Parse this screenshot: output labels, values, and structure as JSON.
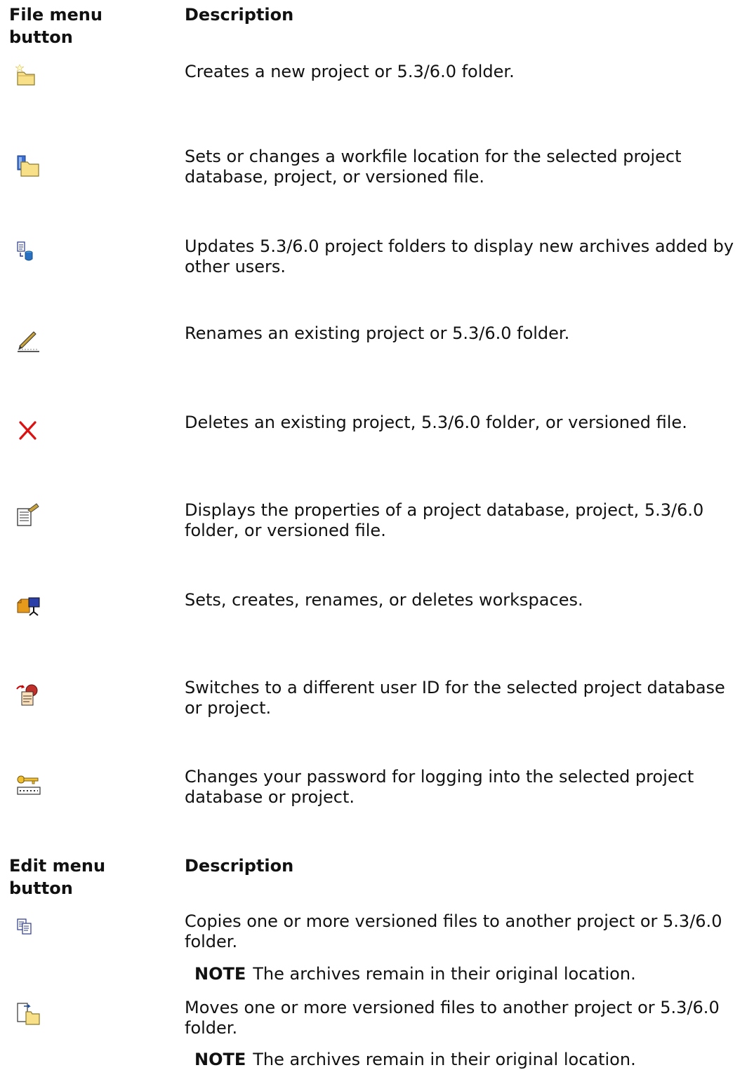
{
  "file_table": {
    "header_button": "File menu button",
    "header_description": "Description",
    "rows": [
      {
        "icon": "new-folder-icon",
        "description": "Creates a new project or 5.3/6.0 folder."
      },
      {
        "icon": "workfile-location-icon",
        "description": "Sets or changes a workfile location for the selected project database, project, or versioned file."
      },
      {
        "icon": "refresh-project-icon",
        "description": "Updates 5.3/6.0 project folders to display new archives added by other users."
      },
      {
        "icon": "rename-icon",
        "description": "Renames an existing project or 5.3/6.0 folder."
      },
      {
        "icon": "delete-icon",
        "description": "Deletes an existing project, 5.3/6.0 folder, or versioned file."
      },
      {
        "icon": "properties-icon",
        "description": "Displays the properties of a project database, project, 5.3/6.0 folder, or versioned file."
      },
      {
        "icon": "workspace-icon",
        "description": "Sets, creates, renames, or deletes workspaces."
      },
      {
        "icon": "switch-user-icon",
        "description": "Switches to a different user ID for the selected project database or project."
      },
      {
        "icon": "password-key-icon",
        "description": "Changes your password for logging into the selected project database or project."
      }
    ]
  },
  "edit_table": {
    "header_button": "Edit menu button",
    "header_description": "Description",
    "rows": [
      {
        "icon": "copy-files-icon",
        "description": "Copies one or more versioned files to another project or 5.3/6.0 folder.",
        "note_label": "NOTE",
        "note_text": "The archives remain in their original location."
      },
      {
        "icon": "move-files-icon",
        "description": "Moves one or more versioned files to another project or 5.3/6.0 folder.",
        "note_label": "NOTE",
        "note_text": "The archives remain in their original location."
      }
    ]
  }
}
